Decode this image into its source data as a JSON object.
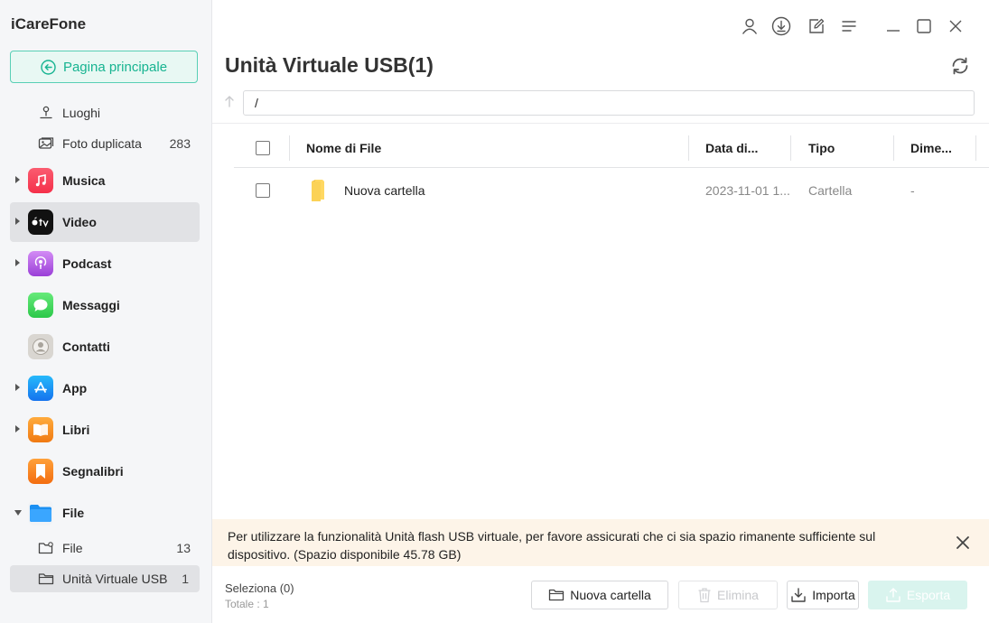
{
  "app": {
    "title": "iCareFone"
  },
  "home_button": {
    "label": "Pagina principale"
  },
  "sidebar": {
    "subitems_top": [
      {
        "label": "Luoghi",
        "count": ""
      },
      {
        "label": "Foto duplicata",
        "count": "283"
      }
    ],
    "items": [
      {
        "label": "Musica",
        "expandable": true
      },
      {
        "label": "Video",
        "expandable": true,
        "active": true
      },
      {
        "label": "Podcast",
        "expandable": true
      },
      {
        "label": "Messaggi",
        "expandable": false
      },
      {
        "label": "Contatti",
        "expandable": false
      },
      {
        "label": "App",
        "expandable": true
      },
      {
        "label": "Libri",
        "expandable": true
      },
      {
        "label": "Segnalibri",
        "expandable": false
      },
      {
        "label": "File",
        "expandable": true,
        "expanded": true
      }
    ],
    "file_subitems": [
      {
        "label": "File",
        "count": "13"
      },
      {
        "label": "Unità Virtuale USB",
        "count": "1",
        "selected": true
      }
    ]
  },
  "main": {
    "title": "Unità Virtuale USB(1)",
    "path": "/",
    "columns": [
      "Nome di File",
      "Data di...",
      "Tipo",
      "Dime..."
    ],
    "rows": [
      {
        "name": "Nuova cartella",
        "date": "2023-11-01 1...",
        "type": "Cartella",
        "size": "-"
      }
    ]
  },
  "notice": {
    "text": "Per utilizzare la funzionalità Unità flash USB virtuale, per favore assicurati che ci sia spazio rimanente sufficiente sul dispositivo. (Spazio disponibile 45.78 GB)"
  },
  "footer": {
    "selection": "Seleziona (0)",
    "total": "Totale : 1",
    "buttons": {
      "new_folder": "Nuova cartella",
      "delete": "Elimina",
      "import": "Importa",
      "export": "Esporta"
    }
  },
  "colors": {
    "accent": "#17b491",
    "accent_bg": "#e8f8f3",
    "notice_bg": "#fdf4e8",
    "sidebar_bg": "#f5f6f8"
  }
}
